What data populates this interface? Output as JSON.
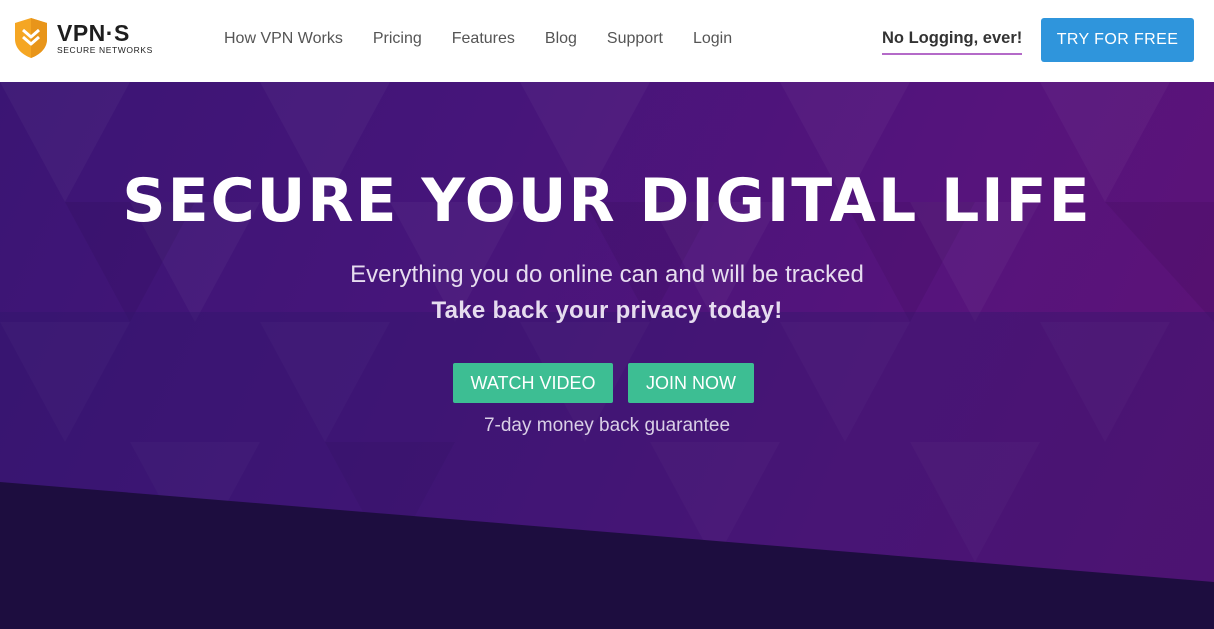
{
  "header": {
    "logo": {
      "title": "VPN·S",
      "subtitle": "SECURE NETWORKS",
      "icon": "shield-chevron-icon"
    },
    "nav": [
      {
        "label": "How VPN Works"
      },
      {
        "label": "Pricing"
      },
      {
        "label": "Features"
      },
      {
        "label": "Blog"
      },
      {
        "label": "Support"
      },
      {
        "label": "Login"
      }
    ],
    "tagline": "No Logging, ever!",
    "cta_label": "TRY FOR FREE"
  },
  "hero": {
    "title": "SECURE YOUR DIGITAL LIFE",
    "subtitle": "Everything you do online can and will be tracked",
    "subtitle_bold": "Take back your privacy today!",
    "watch_label": "WATCH VIDEO",
    "join_label": "JOIN NOW",
    "guarantee": "7-day money back guarantee"
  },
  "colors": {
    "brand_orange": "#f5a623",
    "cta_blue": "#2f95dc",
    "button_green": "#3dbe93",
    "hero_purple": "#46157a",
    "underline_pink": "#b46ac8"
  }
}
